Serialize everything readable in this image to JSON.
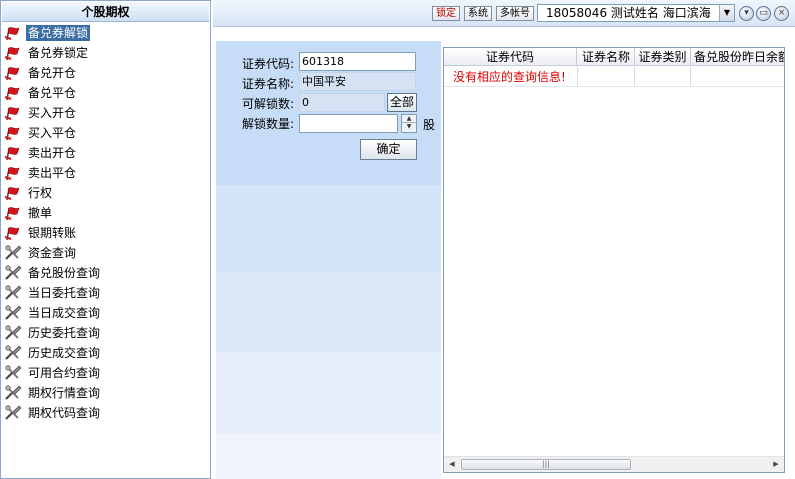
{
  "sidebar": {
    "title": "个股期权",
    "items": [
      {
        "label": "备兑券解锁",
        "icon": "red-flag-icon",
        "selected": true
      },
      {
        "label": "备兑券锁定",
        "icon": "red-flag-icon"
      },
      {
        "label": "备兑开仓",
        "icon": "red-flag-icon"
      },
      {
        "label": "备兑平仓",
        "icon": "red-flag-icon"
      },
      {
        "label": "买入开仓",
        "icon": "red-flag-icon"
      },
      {
        "label": "买入平仓",
        "icon": "red-flag-icon"
      },
      {
        "label": "卖出开仓",
        "icon": "red-flag-icon"
      },
      {
        "label": "卖出平仓",
        "icon": "red-flag-icon"
      },
      {
        "label": "行权",
        "icon": "red-flag-icon"
      },
      {
        "label": "撤单",
        "icon": "red-flag-icon"
      },
      {
        "label": "银期转账",
        "icon": "red-flag-icon"
      },
      {
        "label": "资金查询",
        "icon": "gray-tools-icon"
      },
      {
        "label": "备兑股份查询",
        "icon": "gray-tools-icon"
      },
      {
        "label": "当日委托查询",
        "icon": "gray-tools-icon"
      },
      {
        "label": "当日成交查询",
        "icon": "gray-tools-icon"
      },
      {
        "label": "历史委托查询",
        "icon": "gray-tools-icon"
      },
      {
        "label": "历史成交查询",
        "icon": "gray-tools-icon"
      },
      {
        "label": "可用合约查询",
        "icon": "gray-tools-icon"
      },
      {
        "label": "期权行情查询",
        "icon": "gray-tools-icon"
      },
      {
        "label": "期权代码查询",
        "icon": "gray-tools-icon"
      }
    ]
  },
  "toolbar": {
    "lock_label": "锁定",
    "system_label": "系统",
    "multi_account_label": "多帐号",
    "account_value": "18058046  测试姓名  海口滨海",
    "lock_color": "#c00000"
  },
  "form": {
    "code_label": "证券代码:",
    "code_value": "601318",
    "name_label": "证券名称:",
    "name_value": "中国平安",
    "avail_label": "可解锁数:",
    "avail_value": "0",
    "all_label": "全部",
    "qty_label": "解锁数量:",
    "qty_value": "",
    "unit": "股",
    "confirm_label": "确定"
  },
  "table": {
    "columns": [
      "证券代码",
      "证券名称",
      "证券类别",
      "备兑股份昨日余额"
    ],
    "empty_message": "没有相应的查询信息!",
    "empty_color": "#e00000"
  }
}
